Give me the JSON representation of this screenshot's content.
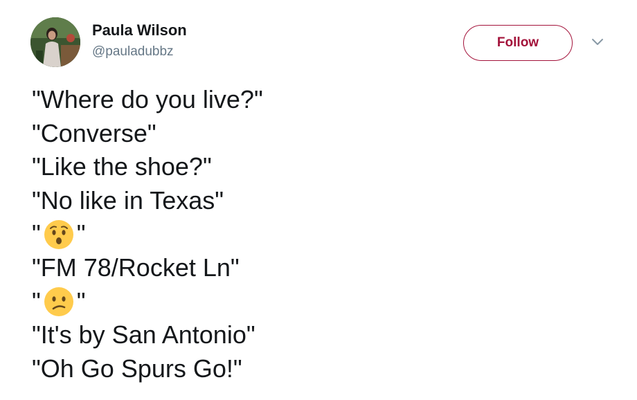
{
  "author": {
    "display_name": "Paula Wilson",
    "handle": "@pauladubbz"
  },
  "actions": {
    "follow_label": "Follow"
  },
  "icons": {
    "more": "chevron-down-icon",
    "emoji_1": "hushed-face-emoji",
    "emoji_2": "confused-face-emoji"
  },
  "colors": {
    "follow_accent": "#a3123a",
    "handle_gray": "#657786",
    "text": "#14171a"
  },
  "tweet": {
    "line1": "\"Where do you live?\"",
    "line2": "\"Converse\"",
    "line3": "\"Like the shoe?\"",
    "line4": "\"No like in Texas\"",
    "line5_open": "\"",
    "line5_close": "\"",
    "line6": "\"FM 78/Rocket Ln\"",
    "line7_open": "\"",
    "line7_close": "\"",
    "line8": "\"It's by San Antonio\"",
    "line9": "\"Oh Go Spurs Go!\""
  }
}
